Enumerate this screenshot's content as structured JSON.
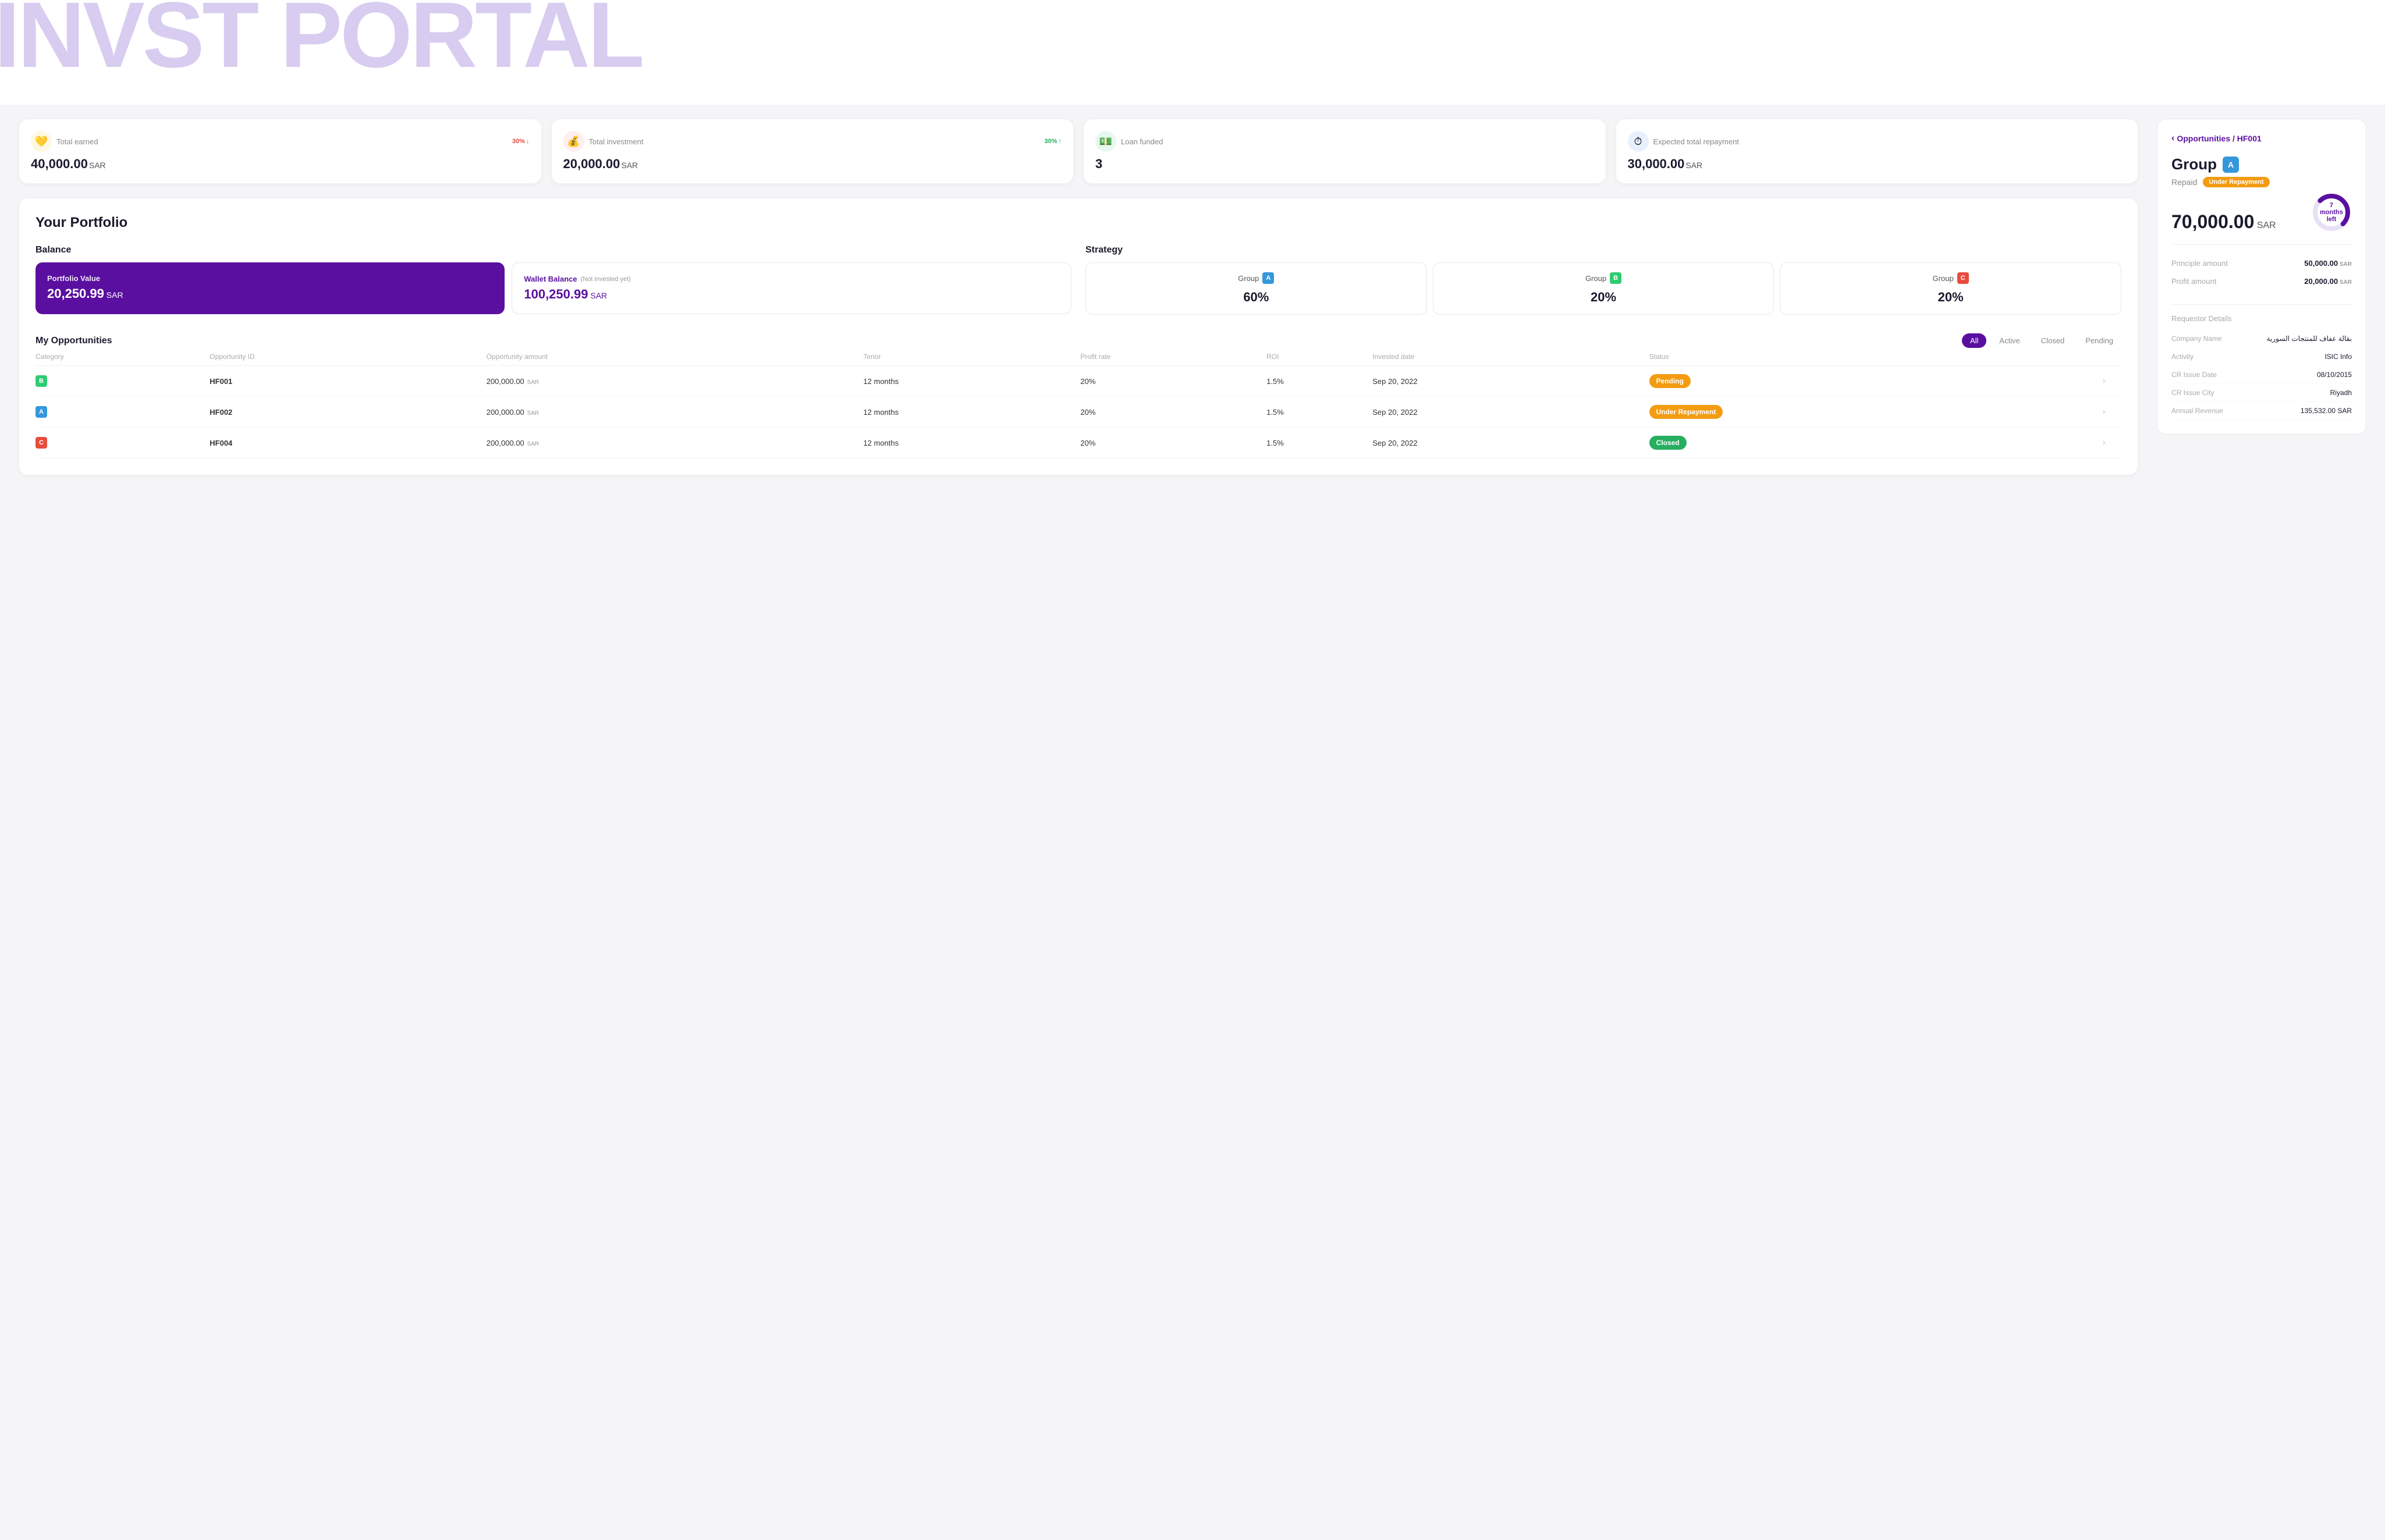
{
  "hero": {
    "text": "INVST PORTAL"
  },
  "stats": {
    "total_earned": {
      "label": "Total earned",
      "value": "40,000.00",
      "currency": "SAR",
      "badge": "30%",
      "badge_direction": "down",
      "icon": "💛"
    },
    "total_investment": {
      "label": "Total investment",
      "value": "20,000.00",
      "currency": "SAR",
      "badge": "30%",
      "badge_direction": "up",
      "icon": "💰"
    },
    "loan_funded": {
      "label": "Loan funded",
      "value": "3",
      "currency": "",
      "icon": "💵"
    },
    "expected_repayment": {
      "label": "Expected total repayment",
      "value": "30,000.00",
      "currency": "SAR",
      "icon": "⏱"
    }
  },
  "portfolio": {
    "title": "Your Portfolio",
    "balance": {
      "title": "Balance",
      "portfolio_value_label": "Portfolio Value",
      "portfolio_value": "20,250.99",
      "portfolio_currency": "SAR",
      "wallet_label": "Wallet Balance",
      "wallet_sublabel": "(Not invested yet)",
      "wallet_value": "100,250.99",
      "wallet_currency": "SAR"
    },
    "strategy": {
      "title": "Strategy",
      "groups": [
        {
          "label": "Group",
          "group": "A",
          "pct": "60%",
          "color": "group-a"
        },
        {
          "label": "Group",
          "group": "B",
          "pct": "20%",
          "color": "group-b"
        },
        {
          "label": "Group",
          "group": "C",
          "pct": "20%",
          "color": "group-c"
        }
      ]
    }
  },
  "opportunities": {
    "title": "My Opportunities",
    "filters": [
      "All",
      "Active",
      "Closed",
      "Pending"
    ],
    "active_filter": "All",
    "columns": [
      "Category",
      "Opportunity ID",
      "Opportunity amount",
      "Tenor",
      "Profit rate",
      "ROI",
      "Invested date",
      "Status",
      ""
    ],
    "rows": [
      {
        "category": "B",
        "category_color": "group-b",
        "opp_id": "HF001",
        "amount": "200,000.00",
        "tenor": "12 months",
        "profit_rate": "20%",
        "roi": "1.5%",
        "invested_date": "Sep 20, 2022",
        "status": "Pending",
        "status_class": "status-pending"
      },
      {
        "category": "A",
        "category_color": "group-a",
        "opp_id": "HF002",
        "amount": "200,000.00",
        "tenor": "12 months",
        "profit_rate": "20%",
        "roi": "1.5%",
        "invested_date": "Sep 20, 2022",
        "status": "Under Repayment",
        "status_class": "status-under-repayment"
      },
      {
        "category": "C",
        "category_color": "group-c",
        "opp_id": "HF004",
        "amount": "200,000.00",
        "tenor": "12 months",
        "profit_rate": "20%",
        "roi": "1.5%",
        "invested_date": "Sep 20, 2022",
        "status": "Closed",
        "status_class": "status-closed"
      }
    ]
  },
  "right_panel": {
    "breadcrumb_back": "‹",
    "breadcrumb_text": "Opportunities / HF001",
    "group_label": "Group",
    "group_letter": "A",
    "repaid_label": "Repaid",
    "repaid_status": "Under Repayment",
    "repaid_amount": "70,000.00",
    "repaid_currency": "SAR",
    "donut_center_line1": "7",
    "donut_center_line2": "months",
    "donut_center_line3": "left",
    "principle_label": "Principle amount",
    "principle_value": "50,000.00",
    "principle_currency": "SAR",
    "profit_label": "Profit amount",
    "profit_value": "20,000.00",
    "profit_currency": "SAR",
    "requestor_title": "Requestor Details",
    "requestor_fields": [
      {
        "label": "Company Name",
        "value": "بقالة عفاف للمنتجات السورية"
      },
      {
        "label": "Activity",
        "value": "ISIC Info"
      },
      {
        "label": "CR Issue Date",
        "value": "08/10/2015"
      },
      {
        "label": "CR Issue City",
        "value": "Riyadh"
      },
      {
        "label": "Annual Revenue",
        "value": "135,532.00 SAR"
      }
    ]
  }
}
